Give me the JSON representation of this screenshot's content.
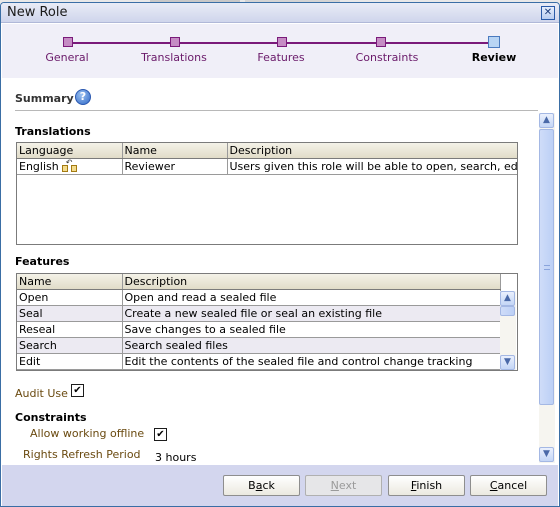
{
  "window": {
    "title": "New Role",
    "close_icon": "close-icon"
  },
  "train": {
    "steps": [
      {
        "label": "General",
        "state": "visited"
      },
      {
        "label": "Translations",
        "state": "visited"
      },
      {
        "label": "Features",
        "state": "visited"
      },
      {
        "label": "Constraints",
        "state": "visited"
      },
      {
        "label": "Review",
        "state": "current"
      }
    ]
  },
  "summary": {
    "title": "Summary",
    "help_icon": "?"
  },
  "translations": {
    "title": "Translations",
    "columns": [
      "Language",
      "Name",
      "Description"
    ],
    "rows": [
      {
        "language": "English",
        "name": "Reviewer",
        "description": "Users given this role will be able to open, search, edit, and p"
      }
    ]
  },
  "features": {
    "title": "Features",
    "columns": [
      "Name",
      "Description"
    ],
    "rows": [
      {
        "name": "Open",
        "description": "Open and read a sealed file"
      },
      {
        "name": "Seal",
        "description": "Create a new sealed file or seal an existing file"
      },
      {
        "name": "Reseal",
        "description": "Save changes to a sealed file"
      },
      {
        "name": "Search",
        "description": "Search sealed files"
      },
      {
        "name": "Edit",
        "description": "Edit the contents of the sealed file and control change tracking"
      }
    ]
  },
  "audit": {
    "label": "Audit Use",
    "checked": true,
    "check_glyph": "✔"
  },
  "constraints": {
    "title": "Constraints",
    "offline_label": "Allow working offline",
    "offline_checked": true,
    "check_glyph": "✔",
    "refresh_label": "Rights Refresh Period",
    "refresh_value": "3 hours"
  },
  "buttons": {
    "back": {
      "pre": "B",
      "key": "a",
      "post": "ck"
    },
    "next": {
      "pre": "",
      "key": "N",
      "post": "ext"
    },
    "finish": {
      "pre": "",
      "key": "F",
      "post": "inish"
    },
    "cancel": {
      "pre": "",
      "key": "C",
      "post": "ancel"
    }
  }
}
